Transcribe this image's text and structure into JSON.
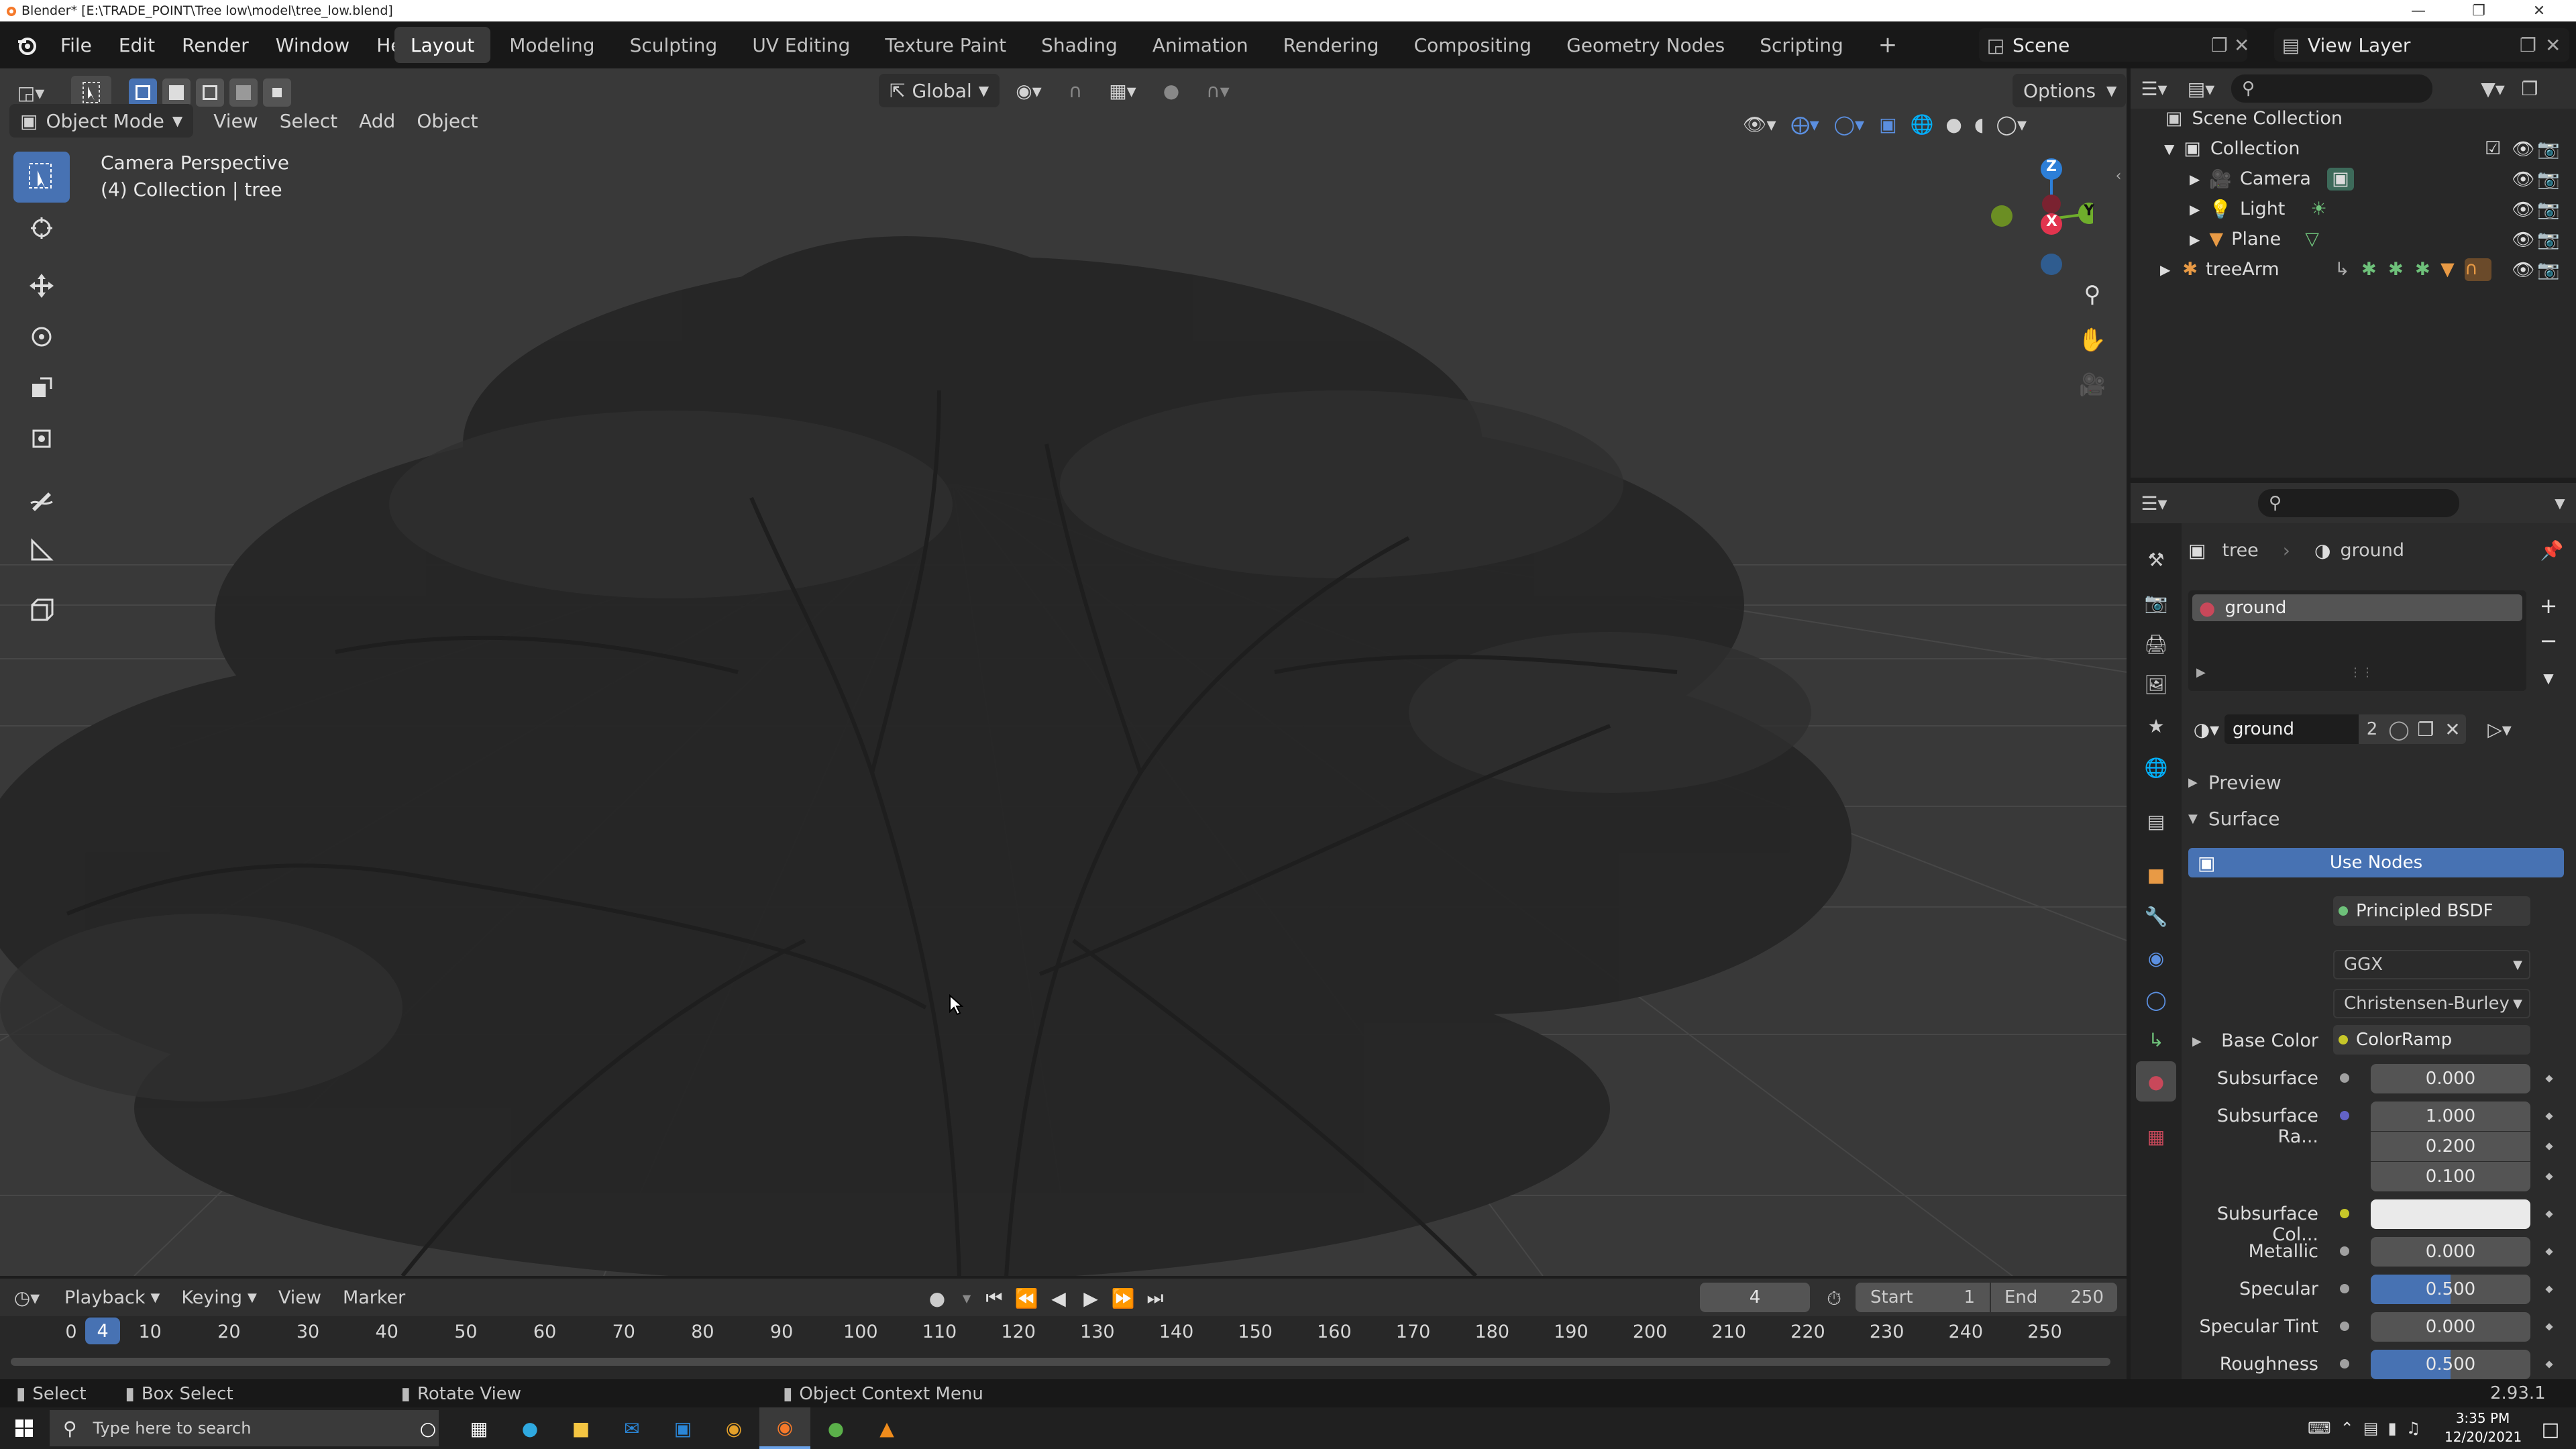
{
  "window": {
    "title": "Blender* [E:\\TRADE_POINT\\Tree low\\model\\tree_low.blend]"
  },
  "menu": {
    "items": [
      "File",
      "Edit",
      "Render",
      "Window",
      "Help"
    ]
  },
  "workspaces": {
    "tabs": [
      "Layout",
      "Modeling",
      "Sculpting",
      "UV Editing",
      "Texture Paint",
      "Shading",
      "Animation",
      "Rendering",
      "Compositing",
      "Geometry Nodes",
      "Scripting"
    ],
    "active": "Layout"
  },
  "scene": {
    "name": "Scene",
    "view_layer": "View Layer"
  },
  "viewport": {
    "mode": "Object Mode",
    "header_menus": [
      "View",
      "Select",
      "Add",
      "Object"
    ],
    "transform_orientation": "Global",
    "options_label": "Options",
    "overlay_title": "Camera Perspective",
    "overlay_subtitle": "(4) Collection | tree",
    "gizmo_axes": {
      "z": "Z",
      "y": "Y",
      "x": "X"
    }
  },
  "outliner": {
    "root": "Scene Collection",
    "collection": "Collection",
    "objects": [
      "Camera",
      "Light",
      "Plane",
      "treeArm"
    ]
  },
  "properties": {
    "breadcrumb_object": "tree",
    "breadcrumb_material": "ground",
    "slot_name": "ground",
    "material_name": "ground",
    "user_count": "2",
    "panels": {
      "preview": "Preview",
      "surface": "Surface"
    },
    "use_nodes_label": "Use Nodes",
    "rows": {
      "surface_label": "Surface",
      "surface_value": "Principled BSDF",
      "distribution": "GGX",
      "subsurface_method": "Christensen-Burley",
      "base_color_label": "Base Color",
      "base_color_value": "ColorRamp",
      "subsurface_label": "Subsurface",
      "subsurface_value": "0.000",
      "subsurface_radius_label": "Subsurface Ra...",
      "subsurface_radius": [
        "1.000",
        "0.200",
        "0.100"
      ],
      "subsurface_color_label": "Subsurface Col...",
      "metallic_label": "Metallic",
      "metallic_value": "0.000",
      "specular_label": "Specular",
      "specular_value": "0.500",
      "specular_tint_label": "Specular Tint",
      "specular_tint_value": "0.000",
      "roughness_label": "Roughness",
      "roughness_value": "0.500"
    },
    "specular_fill": 0.5,
    "roughness_fill": 0.5
  },
  "timeline": {
    "menus": [
      "Playback",
      "Keying",
      "View",
      "Marker"
    ],
    "current_frame": "4",
    "start_label": "Start",
    "start_value": "1",
    "end_label": "End",
    "end_value": "250",
    "ruler": [
      "0",
      "10",
      "20",
      "30",
      "40",
      "50",
      "60",
      "70",
      "80",
      "90",
      "100",
      "110",
      "120",
      "130",
      "140",
      "150",
      "160",
      "170",
      "180",
      "190",
      "200",
      "210",
      "220",
      "230",
      "240",
      "250"
    ],
    "playhead_label": "4"
  },
  "statusbar": {
    "select": "Select",
    "box_select": "Box Select",
    "rotate_view": "Rotate View",
    "context_menu": "Object Context Menu",
    "version": "2.93.1"
  },
  "taskbar": {
    "search_placeholder": "Type here to search",
    "time": "3:35 PM",
    "date": "12/20/2021"
  },
  "colors": {
    "accent": "#4772b3",
    "viewport_bg": "#393939",
    "axis_x": "#e2344e",
    "axis_y": "#6fae2c",
    "axis_z": "#2d7fd8",
    "material_tab": "#c8485a"
  }
}
